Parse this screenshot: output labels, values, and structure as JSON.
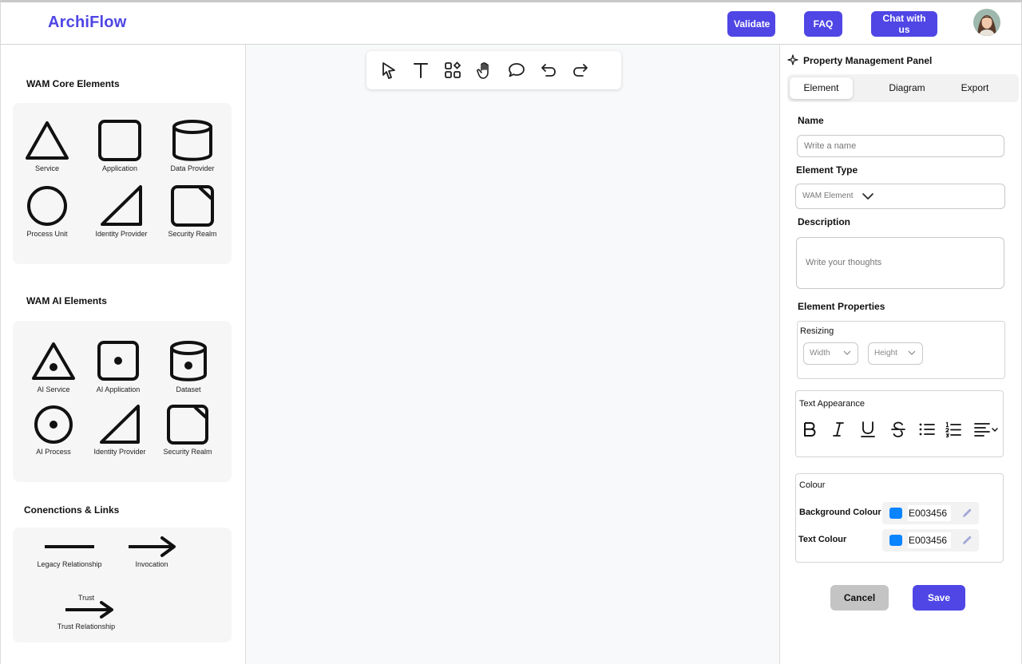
{
  "header": {
    "logo": "ArchiFlow",
    "buttons": {
      "validate": "Validate",
      "faq": "FAQ",
      "chat": "Chat with us"
    }
  },
  "sidebar": {
    "core": {
      "title": "WAM Core Elements",
      "items": [
        "Service",
        "Application",
        "Data Provider",
        "Process Unit",
        "Identity Provider",
        "Security Realm"
      ]
    },
    "ai": {
      "title": "WAM AI Elements",
      "items": [
        "AI Service",
        "AI Application",
        "Dataset",
        "AI Process",
        "Identity Provider",
        "Security Realm"
      ]
    },
    "links": {
      "title": "Conenctions & Links",
      "items": [
        "Legacy Relationship",
        "Invocation",
        "Trust Relationship"
      ],
      "trust_caption": "Trust"
    }
  },
  "toolbar": {
    "tools": [
      "pointer-icon",
      "text-icon",
      "shapes-icon",
      "hand-icon",
      "comment-icon",
      "undo-icon",
      "redo-icon"
    ]
  },
  "panel": {
    "title": "Property Management Panel",
    "tabs": [
      "Element",
      "Diagram",
      "Export"
    ],
    "active_tab": "Element",
    "name_label": "Name",
    "name_placeholder": "Write a name",
    "type_label": "Element Type",
    "type_value": "WAM Element",
    "description_label": "Description",
    "description_placeholder": "Write your thoughts",
    "properties_label": "Element Properties",
    "resizing": {
      "title": "Resizing",
      "width": "Width",
      "height": "Height"
    },
    "text_appearance": {
      "title": "Text Appearance"
    },
    "colour": {
      "title": "Colour",
      "background_label": "Background Colour",
      "background_value": "E003456",
      "text_label": "Text Colour",
      "text_value": "E003456",
      "swatch_color": "#0a84ff"
    },
    "cancel": "Cancel",
    "save": "Save"
  },
  "colors": {
    "accent": "#4f46e5"
  }
}
